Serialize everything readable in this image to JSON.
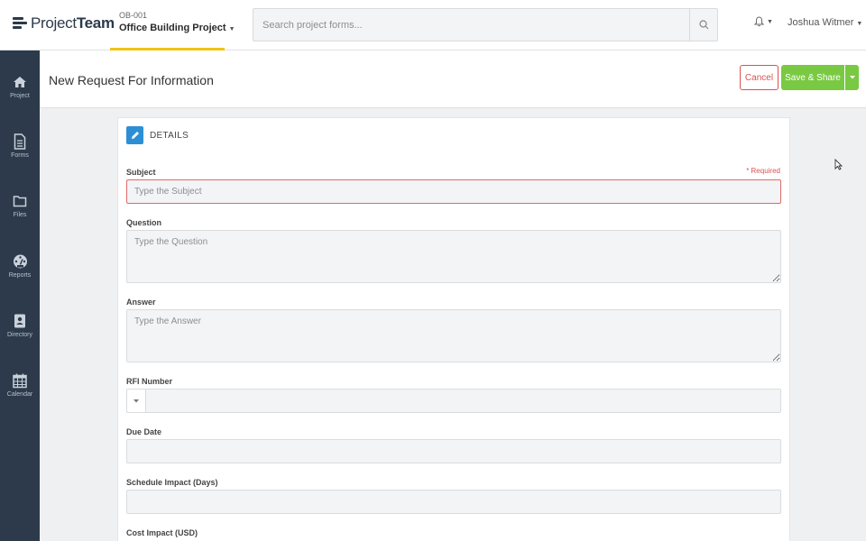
{
  "app": {
    "logo_light": "Project",
    "logo_bold": "Team"
  },
  "project": {
    "code": "OB-001",
    "name": "Office Building Project"
  },
  "search": {
    "placeholder": "Search project forms..."
  },
  "user": {
    "name": "Joshua Witmer"
  },
  "sidebar": {
    "items": [
      {
        "label": "Project",
        "icon": "home-icon"
      },
      {
        "label": "Forms",
        "icon": "document-icon"
      },
      {
        "label": "Files",
        "icon": "folder-icon"
      },
      {
        "label": "Reports",
        "icon": "dashboard-icon"
      },
      {
        "label": "Directory",
        "icon": "contact-book-icon"
      },
      {
        "label": "Calendar",
        "icon": "calendar-icon"
      }
    ]
  },
  "header": {
    "title": "New Request For Information",
    "cancel_label": "Cancel",
    "save_label": "Save & Share"
  },
  "form": {
    "section_title": "DETAILS",
    "required_note": "* Required",
    "subject": {
      "label": "Subject",
      "placeholder": "Type the Subject"
    },
    "question": {
      "label": "Question",
      "placeholder": "Type the Question"
    },
    "answer": {
      "label": "Answer",
      "placeholder": "Type the Answer"
    },
    "rfi_number": {
      "label": "RFI Number"
    },
    "due_date": {
      "label": "Due Date"
    },
    "schedule_impact": {
      "label": "Schedule Impact (Days)"
    },
    "cost_impact": {
      "label": "Cost Impact (USD)"
    }
  },
  "colors": {
    "accent_yellow": "#f0c419",
    "sidebar_bg": "#2c3a4b",
    "save_green": "#7ac943",
    "cancel_red": "#d9534f",
    "section_blue": "#2c8fd6"
  }
}
